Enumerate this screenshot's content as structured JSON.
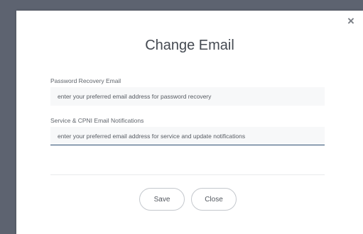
{
  "dialog": {
    "title": "Change Email",
    "close_icon": "close-icon"
  },
  "recovery": {
    "label": "Password Recovery Email",
    "placeholder": "enter your preferred email address for password recovery"
  },
  "notifications": {
    "label": "Service & CPNI Email Notifications",
    "placeholder": "enter your preferred email address for service and update notifications"
  },
  "actions": {
    "save_label": "Save",
    "close_label": "Close"
  },
  "colors": {
    "backdrop": "#5d6370",
    "title": "#454a52",
    "active_underline": "#2e4f73"
  }
}
